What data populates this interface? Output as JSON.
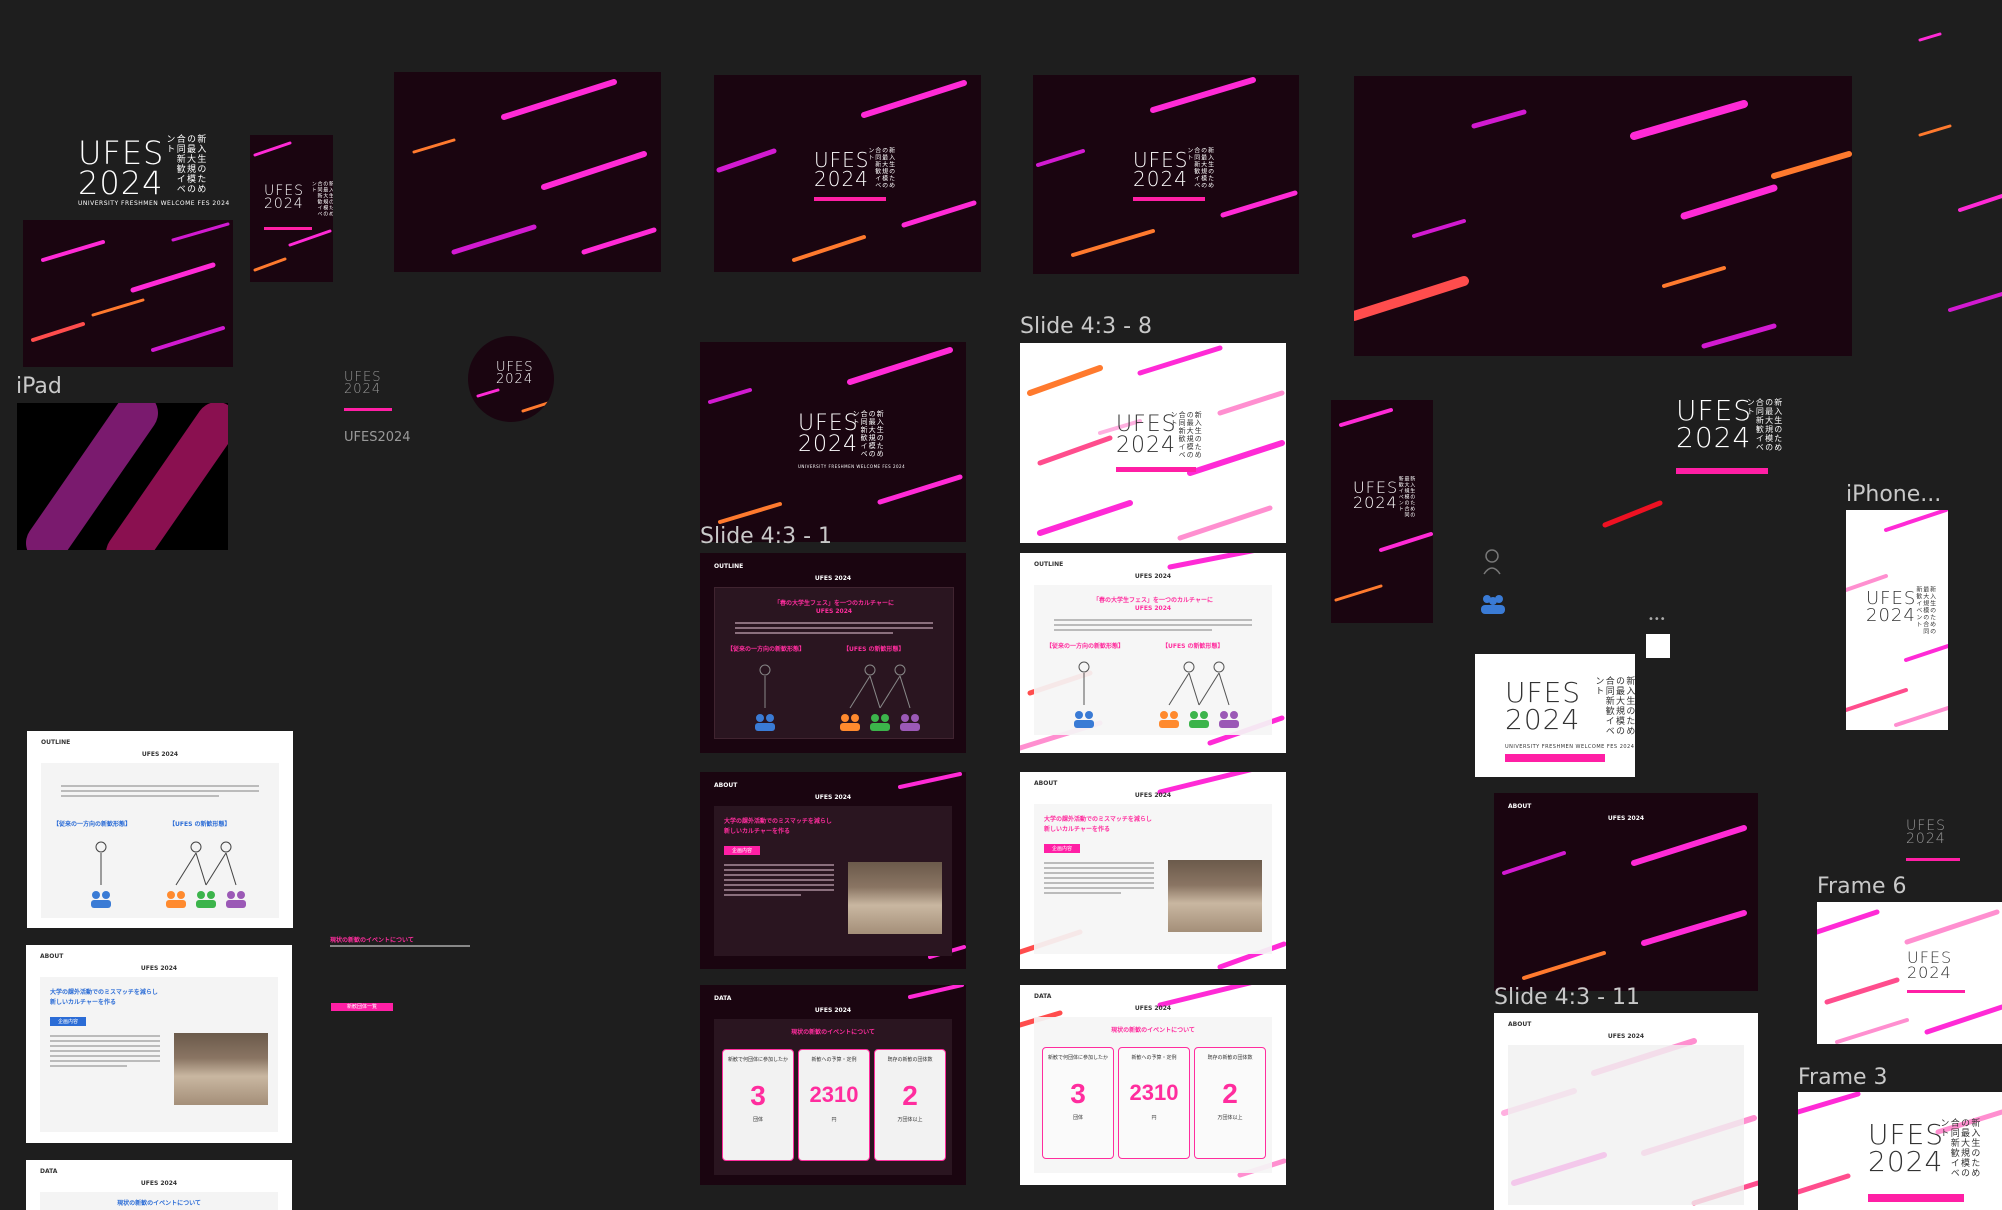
{
  "canvas": {
    "background": "#1e1e1e"
  },
  "brand": {
    "logo_line1": "UFES",
    "logo_line2": "2024",
    "tagline_vertical": "新入生のための最大規模の合同新歓イベント",
    "subtitle": "UNIVERSITY FRESHMEN WELCOME FES 2024",
    "pink": "#ff1fa5",
    "dark_bg": "#1a0510"
  },
  "labels": {
    "ipad": "iPad",
    "slide_1": "Slide 4:3 - 1",
    "slide_8": "Slide 4:3 - 8",
    "slide_11": "Slide 4:3 - 11",
    "iphone": "iPhone...",
    "frame6": "Frame 6",
    "frame3": "Frame 3"
  },
  "slides": {
    "outline_tag": "OUTLINE",
    "about_tag": "ABOUT",
    "data_tag": "DATA",
    "header": "UFES 2024",
    "outline_headline": "「春の大学生フェス」を一つのカルチャーに",
    "outline_sub": "UFES 2024",
    "outline_left": "【従来の一方向の新歓形態】",
    "outline_right": "【UFES の新歓形態】",
    "about_headline_1": "大学の課外活動でのミスマッチを減らし",
    "about_headline_2": "新しいカルチャーを作る",
    "about_badge": "企画内容",
    "data_headline": "現状の新歓のイベントについて",
    "stat1_caption": "新歓で何団体に参加したか",
    "stat1_value": "3",
    "stat1_unit": "団体",
    "stat2_caption": "新歓への予算・定例",
    "stat2_value": "2310",
    "stat2_unit": "円",
    "stat3_caption": "既存の新歓の団体数",
    "stat3_value": "2",
    "stat3_unit": "万団体以上",
    "side_heading": "現状の新歓のイベントについて",
    "side_button": "新歓団体一覧"
  },
  "icons": [
    "ellipsis-icon",
    "person-icon",
    "group-icon"
  ]
}
